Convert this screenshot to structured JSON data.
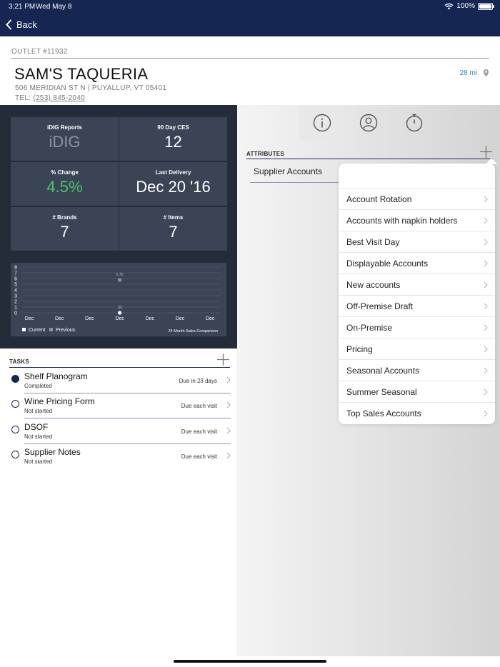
{
  "status_bar": {
    "time": "3:21 PM",
    "date": "Wed May 8",
    "battery": "100%",
    "battery_level": 1.0
  },
  "nav": {
    "back_label": "Back"
  },
  "outlet": {
    "label": "OUTLET #11932",
    "name": "SAM'S TAQUERIA",
    "address": "506 MERIDIAN ST N  |  PUYALLUP, VT 05401",
    "tel_label": "TEL: ",
    "tel_number": "(253) 845-2040",
    "distance": "28 mi"
  },
  "tiles": [
    {
      "title": "iDIG Reports",
      "value": "iDIG"
    },
    {
      "title": "90 Day CES",
      "value": "12"
    },
    {
      "title": "% Change",
      "value": "4.5%"
    },
    {
      "title": "Last Delivery",
      "value": "Dec 20 '16"
    },
    {
      "title": "# Brands",
      "value": "7"
    },
    {
      "title": "# Items",
      "value": "7"
    }
  ],
  "chart_data": {
    "type": "line",
    "categories": [
      "Dec",
      "Dec",
      "Dec",
      "Dec",
      "Dec",
      "Dec",
      "Dec"
    ],
    "series": [
      {
        "name": "Current",
        "values": [
          null,
          null,
          null,
          0,
          null,
          null,
          null
        ]
      },
      {
        "name": "Previous",
        "values": [
          null,
          null,
          null,
          5.75,
          null,
          null,
          null
        ]
      }
    ],
    "data_labels": [
      {
        "series": "Previous",
        "index": 3,
        "text": "5.75"
      },
      {
        "series": "Current",
        "index": 3,
        "text": ".00"
      }
    ],
    "ylim": [
      0,
      8
    ],
    "yticks": [
      "0",
      "1",
      "2",
      "3",
      "4",
      "5",
      "6",
      "7",
      "8"
    ],
    "grid": true,
    "legend": "bottom-left",
    "caption": "24 Month Sales Comparison",
    "colors": {
      "Current": "#ffffff",
      "Previous": "#8c94a3"
    }
  },
  "tasks": {
    "title": "TASKS",
    "items": [
      {
        "name": "Shelf Planogram",
        "status": "Completed",
        "due": "Due in 23 days",
        "completed": true
      },
      {
        "name": "Wine Pricing Form",
        "status": "Not started",
        "due": "Due each visit",
        "completed": false
      },
      {
        "name": "DSOF",
        "status": "Not started",
        "due": "Due each visit",
        "completed": false
      },
      {
        "name": "Supplier Notes",
        "status": "Not started",
        "due": "Due each visit",
        "completed": false
      }
    ]
  },
  "tabs": [
    {
      "icon": "info-icon"
    },
    {
      "icon": "person-icon"
    },
    {
      "icon": "timer-icon"
    }
  ],
  "attributes": {
    "title": "ATTRIBUTES",
    "items": [
      {
        "label": "Supplier Accounts"
      }
    ]
  },
  "popover": {
    "items": [
      {
        "label": "Account Rotation"
      },
      {
        "label": "Accounts with napkin holders"
      },
      {
        "label": "Best Visit Day"
      },
      {
        "label": "Displayable Accounts"
      },
      {
        "label": "New accounts"
      },
      {
        "label": "Off-Premise Draft"
      },
      {
        "label": "On-Premise"
      },
      {
        "label": "Pricing"
      },
      {
        "label": "Seasonal Accounts"
      },
      {
        "label": "Summer Seasonal"
      },
      {
        "label": "Top Sales Accounts"
      }
    ]
  },
  "colors": {
    "nav": "#152653",
    "accent": "#2a83d8",
    "positive": "#4cc36d",
    "dark_panel": "#252c39",
    "tile": "#3a4455"
  }
}
